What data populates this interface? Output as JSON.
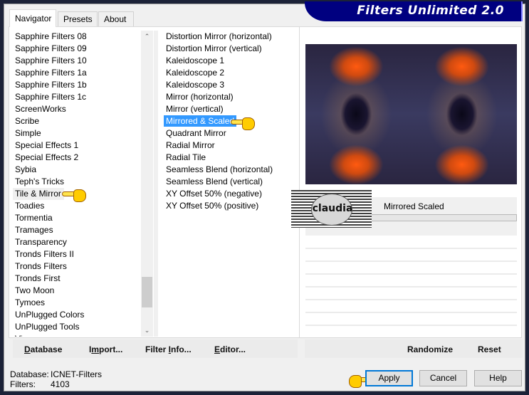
{
  "app": {
    "title": "Filters Unlimited 2.0"
  },
  "tabs": [
    {
      "label": "Navigator",
      "active": true
    },
    {
      "label": "Presets",
      "active": false
    },
    {
      "label": "About",
      "active": false
    }
  ],
  "categories": {
    "items": [
      "Sapphire Filters 08",
      "Sapphire Filters 09",
      "Sapphire Filters 10",
      "Sapphire Filters 1a",
      "Sapphire Filters 1b",
      "Sapphire Filters 1c",
      "ScreenWorks",
      "Scribe",
      "Simple",
      "Special Effects 1",
      "Special Effects 2",
      "Sybia",
      "Teph's Tricks",
      "Tile & Mirror",
      "Toadies",
      "Tormentia",
      "Tramages",
      "Transparency",
      "Tronds Filters II",
      "Tronds Filters",
      "Tronds First",
      "Two Moon",
      "Tymoes",
      "UnPlugged Colors",
      "UnPlugged Tools",
      "Vi..."
    ],
    "selected_index": 13,
    "scroll_position": 0.82
  },
  "filters": {
    "items": [
      "Distortion Mirror (horizontal)",
      "Distortion Mirror (vertical)",
      "Kaleidoscope 1",
      "Kaleidoscope 2",
      "Kaleidoscope 3",
      "Mirror (horizontal)",
      "Mirror (vertical)",
      "Mirrored & Scaled",
      "Quadrant Mirror",
      "Radial Mirror",
      "Radial Tile",
      "Seamless Blend (horizontal)",
      "Seamless Blend (vertical)",
      "XY Offset 50% (negative)",
      "XY Offset 50% (positive)"
    ],
    "selected_index": 7
  },
  "preview": {
    "colors": {
      "dark": "#1a1530",
      "orange": "#ff5a10",
      "blue": "#3a3a60"
    }
  },
  "parameters": {
    "filter_name": "Mirrored  Scaled"
  },
  "watermark": {
    "text": "claudia"
  },
  "left_buttons": {
    "database": {
      "label_pre": "",
      "accel": "D",
      "label_post": "atabase"
    },
    "import": {
      "label_pre": "I",
      "accel": "m",
      "label_post": "port..."
    },
    "filter_info": {
      "label_pre": "Filter ",
      "accel": "I",
      "label_post": "nfo..."
    },
    "editor": {
      "label_pre": "",
      "accel": "E",
      "label_post": "ditor..."
    }
  },
  "right_buttons": {
    "randomize": "Randomize",
    "reset": "Reset"
  },
  "status": {
    "database_label": "Database:",
    "database_value": "ICNET-Filters",
    "filters_label": "Filters:",
    "filters_value": "4103"
  },
  "dialog_buttons": {
    "apply": "Apply",
    "cancel": "Cancel",
    "help": "Help"
  },
  "icons": {
    "scroll_up": "▲",
    "scroll_down": "▼",
    "pointer": "pointing-hand"
  },
  "colors": {
    "banner": "#000080",
    "selection": "#3399ff",
    "default_button_border": "#0078d7",
    "window_bg": "#f0f0f0"
  }
}
